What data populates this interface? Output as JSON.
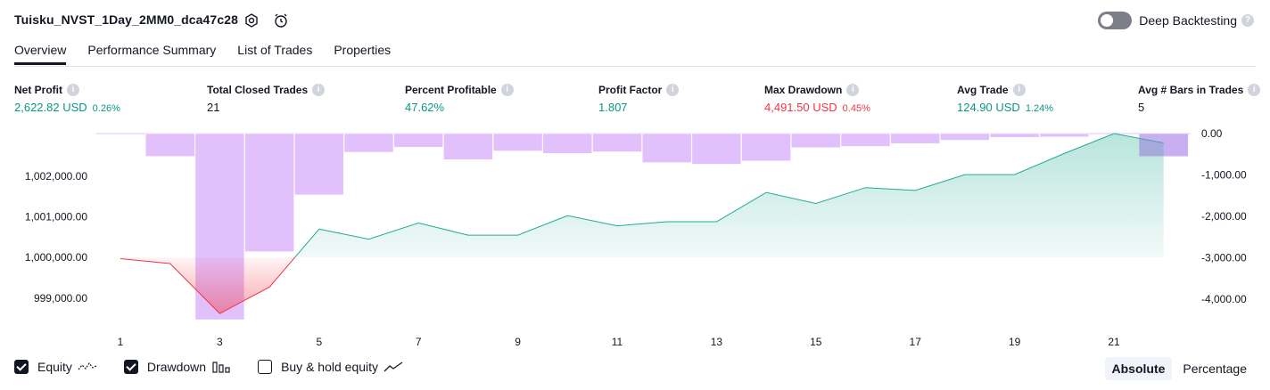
{
  "header": {
    "title": "Tuisku_NVST_1Day_2MM0_dca47c28",
    "deep_backtesting_label": "Deep Backtesting",
    "deep_backtesting_enabled": false
  },
  "tabs": [
    {
      "label": "Overview",
      "active": true
    },
    {
      "label": "Performance Summary",
      "active": false
    },
    {
      "label": "List of Trades",
      "active": false
    },
    {
      "label": "Properties",
      "active": false
    }
  ],
  "metrics": [
    {
      "label": "Net Profit",
      "value": "2,622.82 USD",
      "sub": "0.26%",
      "color": "#089981"
    },
    {
      "label": "Total Closed Trades",
      "value": "21",
      "sub": "",
      "color": "#131722"
    },
    {
      "label": "Percent Profitable",
      "value": "47.62%",
      "sub": "",
      "color": "#089981"
    },
    {
      "label": "Profit Factor",
      "value": "1.807",
      "sub": "",
      "color": "#089981"
    },
    {
      "label": "Max Drawdown",
      "value": "4,491.50 USD",
      "sub": "0.45%",
      "color": "#f23645"
    },
    {
      "label": "Avg Trade",
      "value": "124.90 USD",
      "sub": "1.24%",
      "color": "#089981"
    },
    {
      "label": "Avg # Bars in Trades",
      "value": "5",
      "sub": "",
      "color": "#131722"
    }
  ],
  "legend": {
    "equity_label": "Equity",
    "equity_checked": true,
    "drawdown_label": "Drawdown",
    "drawdown_checked": true,
    "buyhold_label": "Buy & hold equity",
    "buyhold_checked": false
  },
  "modes": {
    "absolute": "Absolute",
    "percentage": "Percentage",
    "active": "Absolute"
  },
  "colors": {
    "equity_line": "#22ab94",
    "equity_loss": "#f23645",
    "drawdown_bar": "#e1c0fb",
    "accent": "#131722"
  },
  "chart_data": {
    "type": "area",
    "x": [
      1,
      2,
      3,
      4,
      5,
      6,
      7,
      8,
      9,
      10,
      11,
      12,
      13,
      14,
      15,
      16,
      17,
      18,
      19,
      20,
      21,
      22
    ],
    "x_tick_labels": [
      "1",
      "3",
      "5",
      "7",
      "9",
      "11",
      "13",
      "15",
      "17",
      "19",
      "21"
    ],
    "equity": {
      "name": "Equity",
      "baseline": 1000000,
      "values": [
        999970,
        999850,
        998620,
        999270,
        1000700,
        1000450,
        1000850,
        1000550,
        1000550,
        1001030,
        1000780,
        1000880,
        1000880,
        1001600,
        1001330,
        1001720,
        1001650,
        1002040,
        1002040,
        1002560,
        1003050,
        1002820
      ]
    },
    "drawdown": {
      "name": "Drawdown",
      "values": [
        0,
        -550,
        -4491.5,
        -2850,
        -1480,
        -450,
        -330,
        -630,
        -420,
        -480,
        -440,
        -700,
        -740,
        -660,
        -340,
        -310,
        -240,
        -160,
        -90,
        -80,
        0,
        -550
      ]
    },
    "left_axis": {
      "ticks": [
        999000,
        1000000,
        1001000,
        1002000
      ],
      "tick_labels": [
        "999,000.00",
        "1,000,000.00",
        "1,001,000.00",
        "1,002,000.00"
      ],
      "range": [
        998470,
        1003050
      ]
    },
    "right_axis": {
      "ticks": [
        0,
        -1000,
        -2000,
        -3000,
        -4000
      ],
      "tick_labels": [
        "0.00",
        "-1,000.00",
        "-2,000.00",
        "-3,000.00",
        "-4,000.00"
      ],
      "range": [
        -4491.5,
        0
      ]
    },
    "grid": false,
    "legend_position": "bottom-left"
  }
}
